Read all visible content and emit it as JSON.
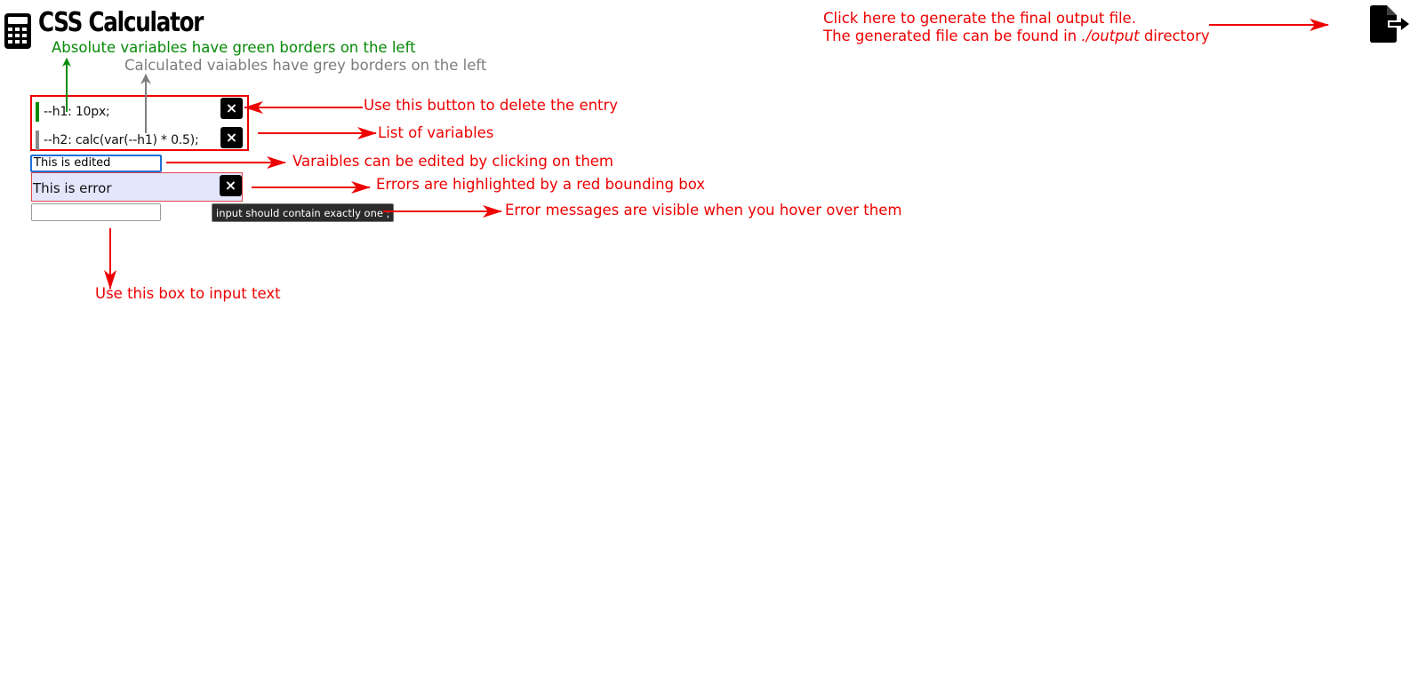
{
  "header": {
    "title": "CSS Calculator",
    "logo_icon": "calculator-icon",
    "export_icon": "file-export-icon"
  },
  "variables": [
    {
      "text": "--h1: 10px;",
      "kind": "absolute",
      "delete_label": "×"
    },
    {
      "text": "--h2: calc(var(--h1) * 0.5);",
      "kind": "calculated",
      "delete_label": "×"
    }
  ],
  "edit_field": {
    "value": "This is edited"
  },
  "error_entry": {
    "text": "This is error",
    "delete_label": "×"
  },
  "new_entry": {
    "value": ""
  },
  "tooltip": {
    "text": "input should contain exactly one ;"
  },
  "annotations": {
    "export_line1": "Click here to generate the final output file.",
    "export_line2_prefix": "The generated file can be found in ",
    "export_line2_path": "./output",
    "export_line2_suffix": " directory",
    "absolute": "Absolute variables have green borders on the left",
    "calculated": "Calculated vaiables have grey borders on the left",
    "delete": "Use this button to delete the entry",
    "list": "List of variables",
    "edit": "Varaibles can be edited by clicking on them",
    "errors": "Errors are highlighted by a red bounding box",
    "error_messages": "Error messages are visible when you hover over them",
    "input": "Use this box to input text"
  },
  "colors": {
    "annotation_red": "#ee0000",
    "absolute_green": "#0a8a0a",
    "calculated_grey": "#8a8a8a",
    "edit_focus_blue": "#1f6fd8",
    "error_bg": "#e4e6fc"
  }
}
